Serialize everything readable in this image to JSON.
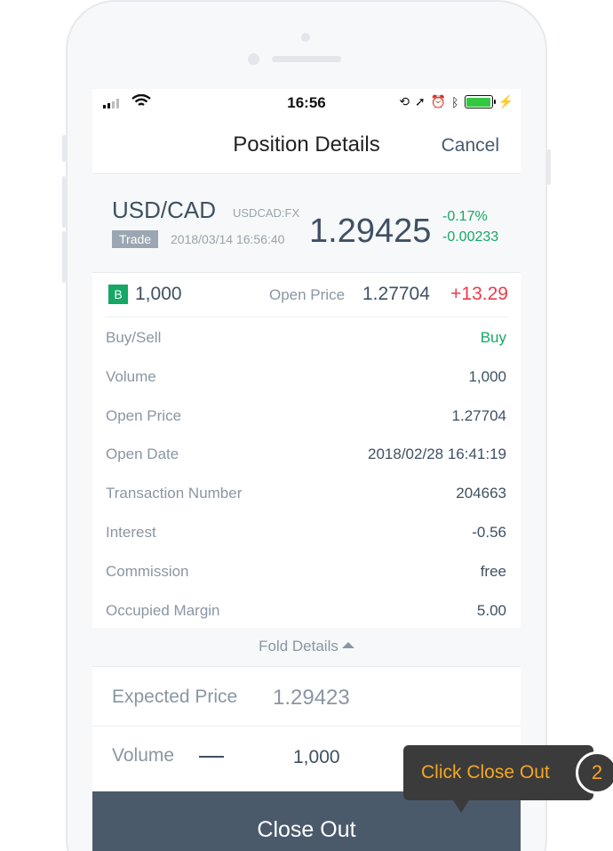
{
  "status_bar": {
    "time": "16:56"
  },
  "nav": {
    "title": "Position Details",
    "cancel_label": "Cancel"
  },
  "quote": {
    "symbol": "USD/CAD",
    "code": "USDCAD:FX",
    "badge": "Trade",
    "timestamp": "2018/03/14 16:56:40",
    "price": "1.29425",
    "change_percent": "-0.17%",
    "change_value": "-0.00233"
  },
  "position": {
    "side_badge": "B",
    "volume": "1,000",
    "open_price_label": "Open Price",
    "open_price": "1.27704",
    "profit_loss": "+13.29"
  },
  "details": [
    {
      "label": "Buy/Sell",
      "value": "Buy"
    },
    {
      "label": "Volume",
      "value": "1,000"
    },
    {
      "label": "Open Price",
      "value": "1.27704"
    },
    {
      "label": "Open Date",
      "value": "2018/02/28 16:41:19"
    },
    {
      "label": "Transaction Number",
      "value": "204663"
    },
    {
      "label": "Interest",
      "value": "-0.56"
    },
    {
      "label": "Commission",
      "value": "free"
    },
    {
      "label": "Occupied Margin",
      "value": "5.00"
    }
  ],
  "fold_label": "Fold Details",
  "expected": {
    "label": "Expected Price",
    "value": "1.29423"
  },
  "volume_input": {
    "label": "Volume",
    "value": "1,000",
    "plus": "+"
  },
  "close_out_label": "Close Out",
  "tooltip": {
    "text": "Click Close Out",
    "step": "2"
  },
  "colors": {
    "green": "#15a866",
    "red": "#ee3a4b",
    "button": "#4b5a6b",
    "tooltip_bg": "#3b3b3b",
    "tooltip_text": "#f5a623"
  }
}
